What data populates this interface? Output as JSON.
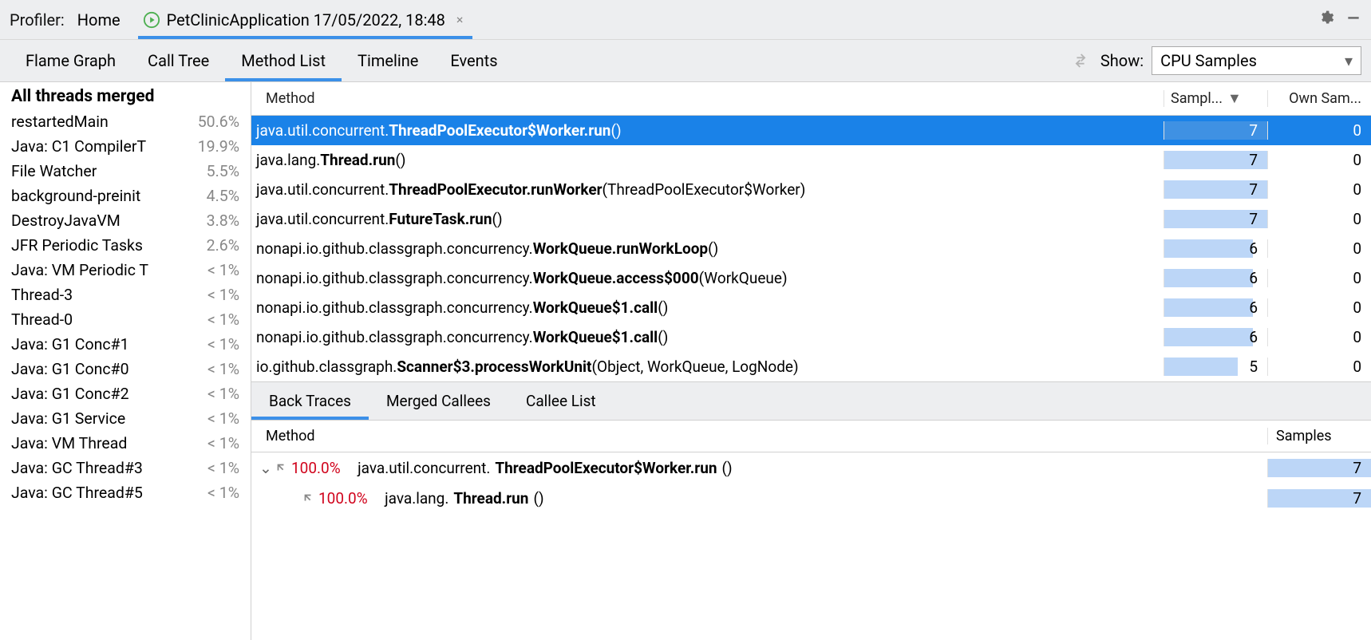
{
  "topbar": {
    "profiler_label": "Profiler:",
    "home": "Home",
    "tab_title": "PetClinicApplication 17/05/2022, 18:48",
    "close_glyph": "×"
  },
  "viewbar": {
    "tabs": [
      "Flame Graph",
      "Call Tree",
      "Method List",
      "Timeline",
      "Events"
    ],
    "selected_index": 2,
    "show_label": "Show:",
    "show_value": "CPU Samples"
  },
  "sidebar": {
    "header": "All threads merged",
    "items": [
      {
        "name": "restartedMain",
        "pct": "50.6%"
      },
      {
        "name": "Java: C1 CompilerT",
        "pct": "19.9%"
      },
      {
        "name": "File Watcher",
        "pct": "5.5%"
      },
      {
        "name": "background-preinit",
        "pct": "4.5%"
      },
      {
        "name": "DestroyJavaVM",
        "pct": "3.8%"
      },
      {
        "name": "JFR Periodic Tasks",
        "pct": "2.6%"
      },
      {
        "name": "Java: VM Periodic T",
        "pct": "< 1%"
      },
      {
        "name": "Thread-3",
        "pct": "< 1%"
      },
      {
        "name": "Thread-0",
        "pct": "< 1%"
      },
      {
        "name": "Java: G1 Conc#1",
        "pct": "< 1%"
      },
      {
        "name": "Java: G1 Conc#0",
        "pct": "< 1%"
      },
      {
        "name": "Java: G1 Conc#2",
        "pct": "< 1%"
      },
      {
        "name": "Java: G1 Service",
        "pct": "< 1%"
      },
      {
        "name": "Java: VM Thread",
        "pct": "< 1%"
      },
      {
        "name": "Java: GC Thread#3",
        "pct": "< 1%"
      },
      {
        "name": "Java: GC Thread#5",
        "pct": "< 1%"
      }
    ]
  },
  "method_table": {
    "headers": {
      "method": "Method",
      "samples": "Sampl...",
      "own": "Own Sam..."
    },
    "max_samples": 7,
    "rows": [
      {
        "pkg": "java.util.concurrent.",
        "bold": "ThreadPoolExecutor$Worker.run",
        "suffix": "()",
        "samples": 7,
        "own": 0,
        "selected": true
      },
      {
        "pkg": "java.lang.",
        "bold": "Thread.run",
        "suffix": "()",
        "samples": 7,
        "own": 0
      },
      {
        "pkg": "java.util.concurrent.",
        "bold": "ThreadPoolExecutor.runWorker",
        "suffix": "(ThreadPoolExecutor$Worker)",
        "samples": 7,
        "own": 0
      },
      {
        "pkg": "java.util.concurrent.",
        "bold": "FutureTask.run",
        "suffix": "()",
        "samples": 7,
        "own": 0
      },
      {
        "pkg": "nonapi.io.github.classgraph.concurrency.",
        "bold": "WorkQueue.runWorkLoop",
        "suffix": "()",
        "samples": 6,
        "own": 0
      },
      {
        "pkg": "nonapi.io.github.classgraph.concurrency.",
        "bold": "WorkQueue.access$000",
        "suffix": "(WorkQueue)",
        "samples": 6,
        "own": 0
      },
      {
        "pkg": "nonapi.io.github.classgraph.concurrency.",
        "bold": "WorkQueue$1.call",
        "suffix": "()",
        "samples": 6,
        "own": 0
      },
      {
        "pkg": "nonapi.io.github.classgraph.concurrency.",
        "bold": "WorkQueue$1.call",
        "suffix": "()",
        "samples": 6,
        "own": 0
      },
      {
        "pkg": "io.github.classgraph.",
        "bold": "Scanner$3.processWorkUnit",
        "suffix": "(Object, WorkQueue, LogNode)",
        "samples": 5,
        "own": 0
      }
    ]
  },
  "lowerbar": {
    "tabs": [
      "Back Traces",
      "Merged Callees",
      "Callee List"
    ],
    "selected_index": 0
  },
  "backtraces": {
    "headers": {
      "method": "Method",
      "samples": "Samples"
    },
    "max_samples": 7,
    "rows": [
      {
        "indent": 0,
        "expander": "v",
        "pct": "100.0%",
        "pkg": "java.util.concurrent.",
        "bold": "ThreadPoolExecutor$Worker.run",
        "suffix": "()",
        "samples": 7
      },
      {
        "indent": 1,
        "expander": "",
        "pct": "100.0%",
        "pkg": "java.lang.",
        "bold": "Thread.run",
        "suffix": "()",
        "samples": 7
      }
    ]
  }
}
